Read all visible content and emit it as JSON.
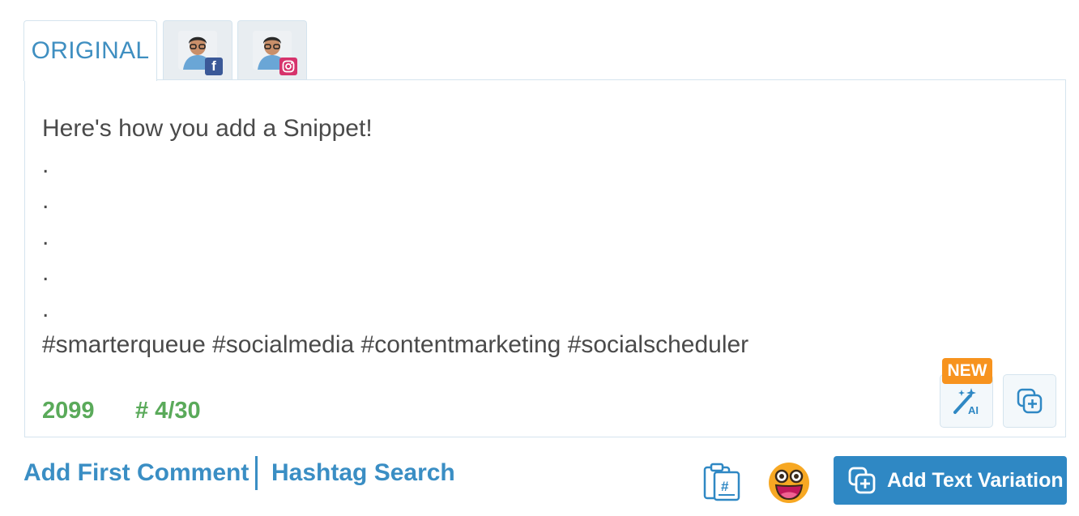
{
  "tabs": {
    "original_label": "ORIGINAL",
    "profiles": [
      {
        "network": "facebook",
        "badge_icon": "facebook-icon",
        "badge_glyph": "f"
      },
      {
        "network": "instagram",
        "badge_icon": "instagram-icon"
      }
    ]
  },
  "editor": {
    "text": "Here's how you add a Snippet!\n.\n.\n.\n.\n.\n#smarterqueue #socialmedia #contentmarketing #socialscheduler",
    "char_count": "2099",
    "hashtag_count": "# 4/30",
    "new_badge": "NEW",
    "ai_button_icon": "magic-wand-ai-icon",
    "duplicate_button_icon": "duplicate-icon"
  },
  "footer": {
    "add_first_comment": "Add First Comment",
    "hashtag_search": "Hashtag Search",
    "snippet_icon": "snippet-clipboard-icon",
    "emoji_icon": "emoji-icon",
    "add_text_variation": "Add Text Variation"
  },
  "colors": {
    "accent": "#3a8ec4",
    "button": "#2f88c4",
    "counter": "#5aaa5a",
    "new_badge": "#f7931e"
  }
}
